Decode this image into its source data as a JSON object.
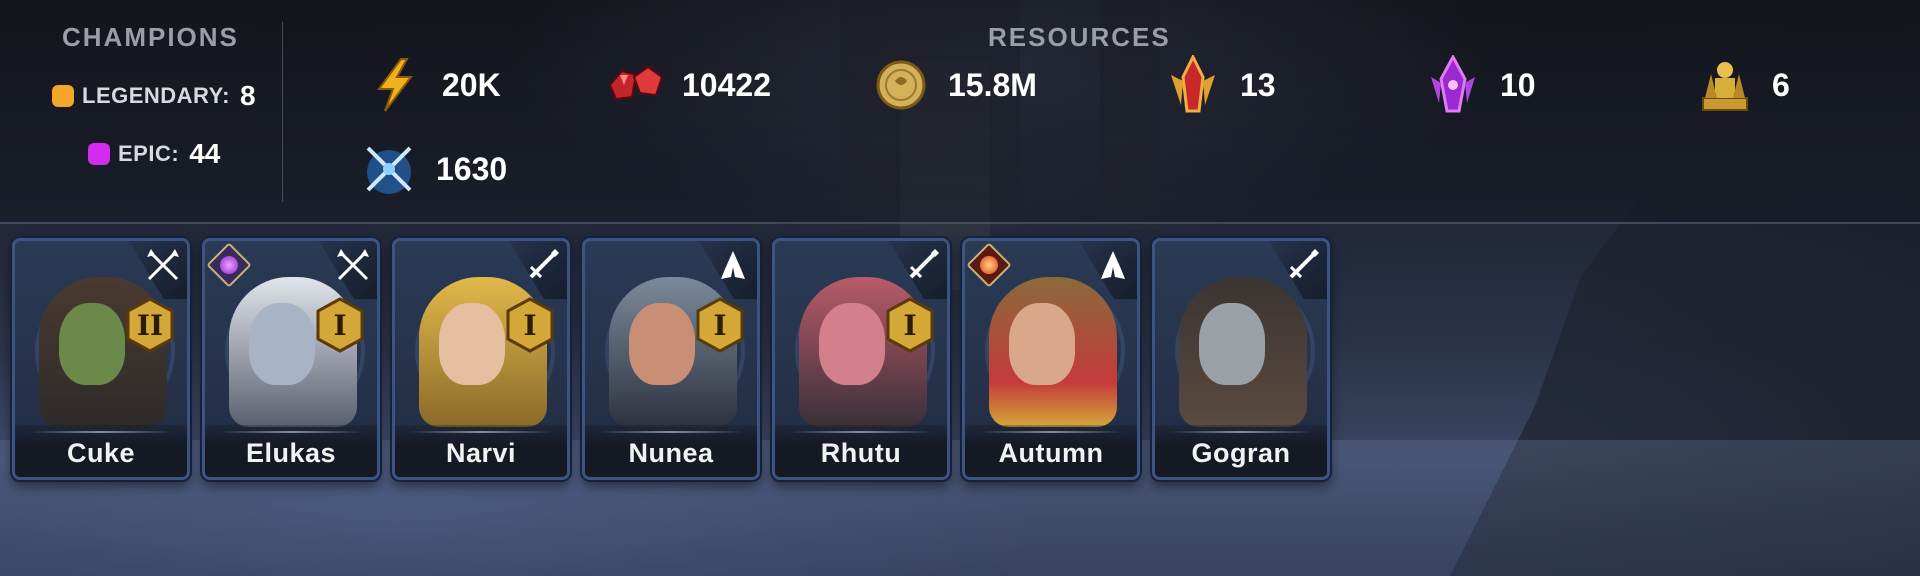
{
  "champions_panel": {
    "title": "CHAMPIONS",
    "rarities": [
      {
        "label": "LEGENDARY:",
        "count": "8",
        "color": "#f4a62a"
      },
      {
        "label": "EPIC:",
        "count": "44",
        "color": "#d12cf0"
      }
    ]
  },
  "resources_panel": {
    "title": "RESOURCES",
    "items": [
      {
        "icon": "energy-icon",
        "value": "20K"
      },
      {
        "icon": "rubies-icon",
        "value": "10422"
      },
      {
        "icon": "silver-coin-icon",
        "value": "15.8M"
      },
      {
        "icon": "sacred-shard-icon",
        "value": "13"
      },
      {
        "icon": "void-shard-icon",
        "value": "10"
      },
      {
        "icon": "gold-statue-icon",
        "value": "6"
      },
      {
        "icon": "arena-token-icon",
        "value": "1630"
      }
    ]
  },
  "champions": [
    {
      "name": "Cuke",
      "rank": "II",
      "role_icon": "attack-arrows-icon",
      "affinity": null,
      "skin": "#6b8a4a",
      "hair": "#4a3a30"
    },
    {
      "name": "Elukas",
      "rank": "I",
      "role_icon": "attack-arrows-icon",
      "affinity": "void",
      "skin": "#a8b4c6",
      "hair": "#e0e4ea"
    },
    {
      "name": "Narvi",
      "rank": "I",
      "role_icon": "sword-icon",
      "affinity": null,
      "skin": "#e6bfa0",
      "hair": "#e2b84a"
    },
    {
      "name": "Nunea",
      "rank": "I",
      "role_icon": "praying-hands-icon",
      "affinity": null,
      "skin": "#c98f74",
      "hair": "#7a8a9a"
    },
    {
      "name": "Rhutu",
      "rank": "I",
      "role_icon": "sword-icon",
      "affinity": null,
      "skin": "#d4808c",
      "hair": "#b85a6a"
    },
    {
      "name": "Autumn",
      "rank": null,
      "role_icon": "praying-hands-icon",
      "affinity": "force",
      "skin": "#d9a888",
      "hair": "#c43a3a"
    },
    {
      "name": "Gogran",
      "rank": null,
      "role_icon": "sword-icon",
      "affinity": null,
      "skin": "#9aa0a6",
      "hair": "#3b3432"
    }
  ]
}
